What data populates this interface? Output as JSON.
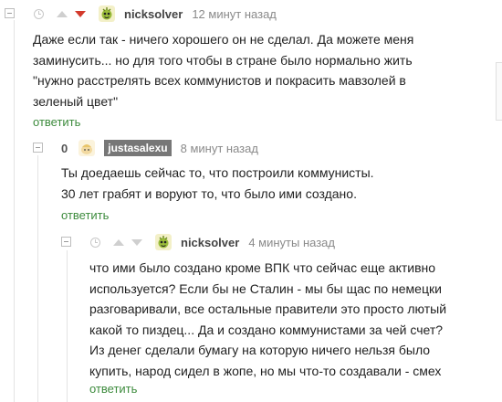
{
  "comments": [
    {
      "author": "nicksolver",
      "time": "12 минут назад",
      "lines": [
        "Даже если так - ничего хорошего он не сделал. Да можете меня",
        "заминусить... но для того чтобы в стране было нормально жить",
        "\"нужно расстрелять всех коммунистов и покрасить мавзолей в",
        "зеленый цвет\""
      ],
      "reply_label": "ответить",
      "vote_down_active": true
    },
    {
      "author": "justasalexu",
      "rating": "0",
      "time": "8 минут назад",
      "lines": [
        "Ты доедаешь сейчас то, что построили коммунисты.",
        "30 лет грабят и воруют то, что было ими создано."
      ],
      "reply_label": "ответить"
    },
    {
      "author": "nicksolver",
      "time": "4 минуты назад",
      "lines": [
        "что ими было создано кроме ВПК что сейчас еще активно",
        "используется? Если бы не Сталин - мы бы щас по немецки",
        "разговаривали, все остальные правители это просто лютый",
        "какой то пиздец...  Да и создано коммунистами за чей счет?",
        "Из денег сделали бумагу на которую ничего нельзя было",
        "купить, народ сидел в жопе, но  мы что-то создавали - смех"
      ],
      "reply_label": "ответить"
    }
  ],
  "colors": {
    "downvote_active": "#d33a2c",
    "reply_link": "#3d8b3d",
    "badge_bg": "#777777"
  }
}
